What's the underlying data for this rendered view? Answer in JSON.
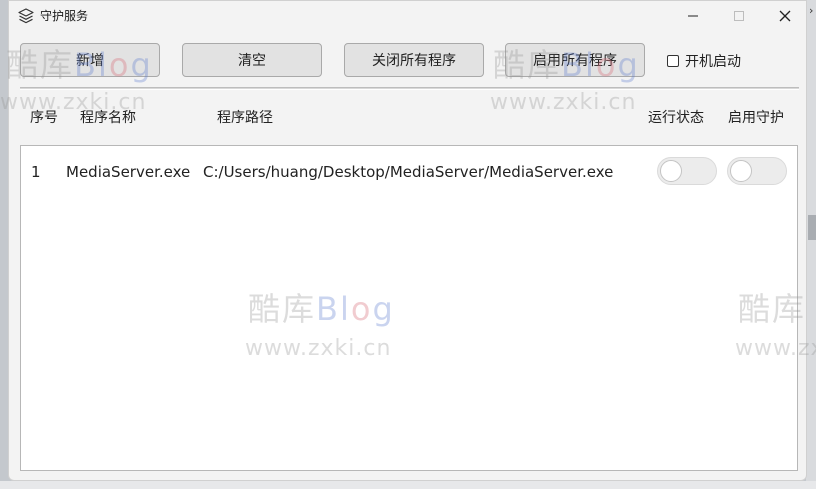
{
  "window": {
    "title": "守护服务"
  },
  "toolbar": {
    "add_label": "新增",
    "clear_label": "清空",
    "close_all_label": "关闭所有程序",
    "start_all_label": "启用所有程序",
    "autostart_label": "开机启动",
    "autostart_checked": false
  },
  "table": {
    "columns": [
      "序号",
      "程序名称",
      "程序路径",
      "运行状态",
      "启用守护"
    ],
    "rows": [
      {
        "index": "1",
        "name": "MediaServer.exe",
        "path": "C:/Users/huang/Desktop/MediaServer/MediaServer.exe",
        "running": false,
        "guard_enabled": false
      }
    ]
  },
  "watermark": {
    "brand_cn": "酷库",
    "brand_en_b": "Bl",
    "brand_en_o": "o",
    "brand_en_g": "g",
    "url": "www.zxki.cn"
  }
}
